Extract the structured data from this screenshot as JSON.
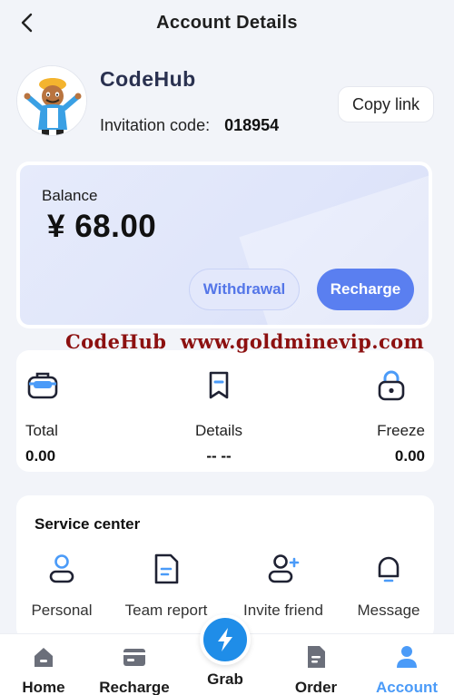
{
  "header": {
    "title": "Account Details"
  },
  "profile": {
    "username": "CodeHub",
    "invitation_label": "Invitation code:",
    "invitation_code": "018954",
    "copy_label": "Copy link"
  },
  "balance": {
    "label": "Balance",
    "amount": "¥ 68.00",
    "withdraw_label": "Withdrawal",
    "recharge_label": "Recharge"
  },
  "watermark": "CodeHub  www.goldminevip.com",
  "stats": {
    "total": {
      "label": "Total",
      "value": "0.00"
    },
    "details": {
      "label": "Details",
      "value": "-- --"
    },
    "freeze": {
      "label": "Freeze",
      "value": "0.00"
    }
  },
  "service": {
    "title": "Service center",
    "items": [
      {
        "label": "Personal",
        "icon": "person-icon"
      },
      {
        "label": "Team report",
        "icon": "report-icon"
      },
      {
        "label": "Invite friend",
        "icon": "add-user-icon"
      },
      {
        "label": "Message",
        "icon": "bell-icon"
      }
    ]
  },
  "tabbar": {
    "items": [
      {
        "label": "Home",
        "icon": "home-icon"
      },
      {
        "label": "Recharge",
        "icon": "card-icon"
      },
      {
        "label": "Grab",
        "icon": "lightning-icon"
      },
      {
        "label": "Order",
        "icon": "document-icon"
      },
      {
        "label": "Account",
        "icon": "user-icon",
        "active": true
      }
    ]
  },
  "colors": {
    "accent": "#5a7ff0",
    "active_tab": "#4b9bf8",
    "grab": "#1f8de8",
    "watermark": "#8c1010",
    "background": "#f2f4f9"
  }
}
